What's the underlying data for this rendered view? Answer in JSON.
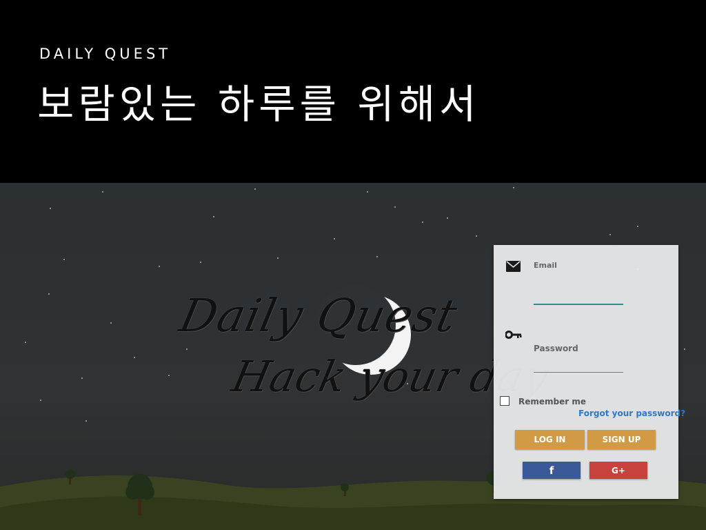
{
  "slide": {
    "eyebrow": "DAILY QUEST",
    "headline": "보람있는 하루를 위해서"
  },
  "logo": {
    "line1": "Daily Quest",
    "line2": "Hack your day"
  },
  "login": {
    "email_label": "Email",
    "email_value": "",
    "password_label": "Password",
    "password_value": "",
    "remember_label": "Remember me",
    "remember_checked": false,
    "forgot_label": "Forgot your password?",
    "login_button": "LOG IN",
    "signup_button": "SIGN UP",
    "facebook_button": "f",
    "google_button": "G+"
  },
  "icons": {
    "email": "envelope-icon",
    "password": "key-icon",
    "moon": "crescent-moon-icon"
  },
  "colors": {
    "accent_button": "#d39a45",
    "facebook": "#3b5998",
    "google": "#c9413c",
    "link": "#2d79c7",
    "active_underline": "#2a8f86"
  }
}
